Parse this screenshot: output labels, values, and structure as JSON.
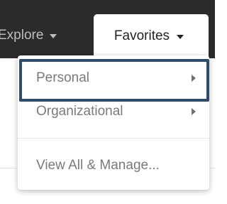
{
  "nav": {
    "explore_label": "Explore",
    "favorites_label": "Favorites"
  },
  "menu": {
    "items": [
      {
        "label": "Personal",
        "has_submenu": true,
        "highlighted": true
      },
      {
        "label": "Organizational",
        "has_submenu": true,
        "highlighted": false
      },
      {
        "label": "View All & Manage...",
        "has_submenu": false,
        "highlighted": false
      }
    ]
  },
  "colors": {
    "navbar_bg": "#2b2b2b",
    "highlight_border": "#2f4b6e",
    "menu_text": "#7a7a7a"
  },
  "icons": {
    "explore_caret": "chevron-down-icon",
    "favorites_caret": "chevron-down-icon",
    "submenu_arrow": "chevron-right-icon"
  }
}
